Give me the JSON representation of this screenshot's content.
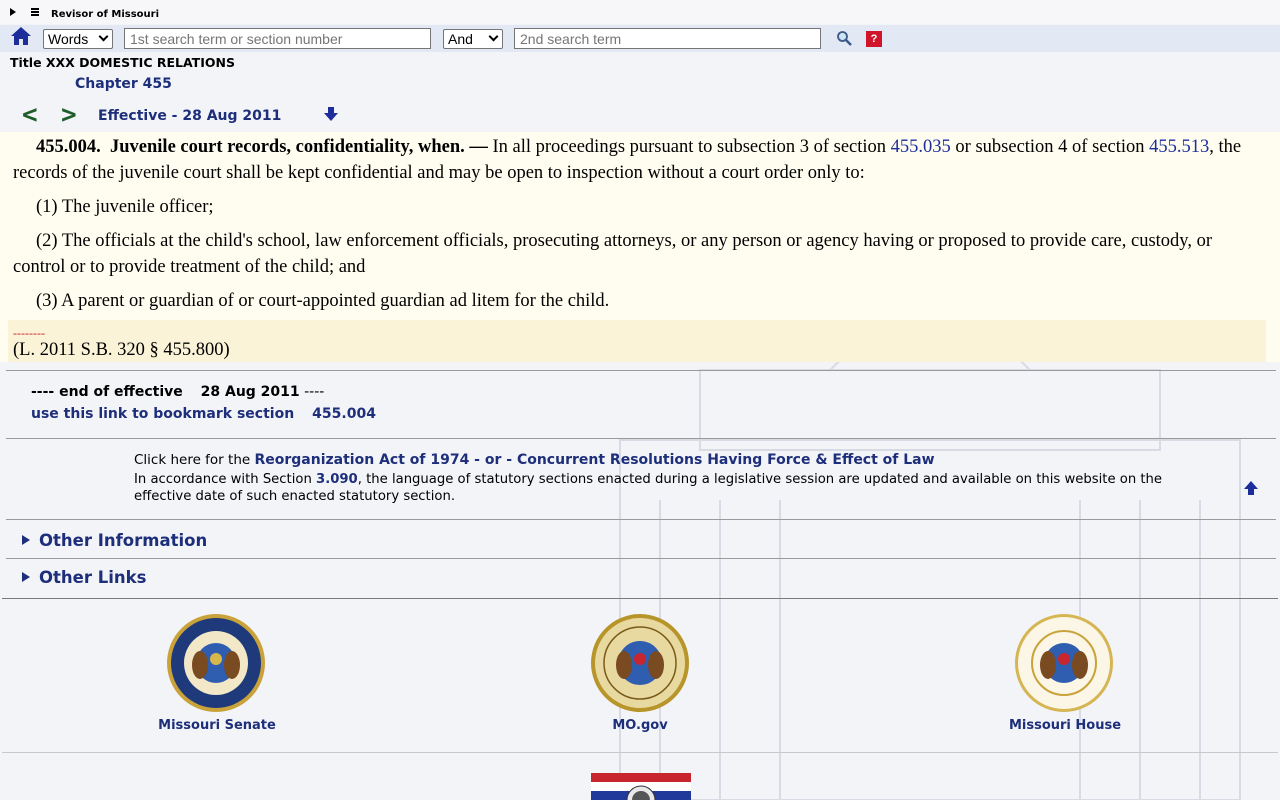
{
  "topbar": {
    "brand": "Revisor of Missouri"
  },
  "search": {
    "mode_selected": "Words",
    "term1_placeholder": "1st search term or section number",
    "operator_selected": "And",
    "term2_placeholder": "2nd search term",
    "help_label": "?"
  },
  "heading": {
    "title": "Title XXX DOMESTIC RELATIONS",
    "chapter": "Chapter 455",
    "prev": "<",
    "next": ">",
    "effective": "Effective - 28 Aug 2011"
  },
  "section": {
    "number": "455.004.",
    "heading": "Juvenile court records, confidentiality, when.",
    "dash": "—",
    "intro_a": "In all proceedings pursuant to subsection 3 of section",
    "link1": "455.035",
    "intro_b": "or subsection 4 of section",
    "link2": "455.513",
    "intro_c": ", the records of the juvenile court shall be kept confidential and may be open to inspection without a court order only to:",
    "item1": "(1)  The juvenile officer;",
    "item2": "(2)  The officials at the child's school, law enforcement officials, prosecuting attorneys, or any person or agency having or proposed to provide care, custody, or control or to provide treatment of the child; and",
    "item3": "(3)  A parent or guardian of or court-appointed guardian ad litem for the child.",
    "dashes": "--------",
    "history": "(L. 2011 S.B. 320 § 455.800)"
  },
  "end": {
    "prefix": "---- end of effective",
    "date": "28 Aug 2011",
    "suffix": "----",
    "bookmark_text": "use this link to bookmark section",
    "bookmark_section": "455.004"
  },
  "notice": {
    "click_prefix": "Click here for the",
    "click_link": "Reorganization Act of 1974 - or - Concurrent Resolutions Having Force & Effect of Law",
    "acc_prefix": "In accordance with Section",
    "acc_section": "3.090",
    "acc_rest": ", the language of statutory sections enacted during a legislative session are updated and available on this website on the effective date of such enacted statutory section."
  },
  "sections": {
    "other_information": "Other Information",
    "other_links": "Other Links"
  },
  "footer": {
    "senate": "Missouri Senate",
    "mogov": "MO.gov",
    "house": "Missouri House"
  },
  "colors": {
    "link_blue": "#1d2e7a",
    "nav_green": "#1e5e2a",
    "search_bar": "#e3e8f5",
    "statute_bg": "#fffdf0",
    "history_bg": "#fbf3d8",
    "help_red": "#d0152a"
  },
  "icons": [
    "home-icon",
    "search-icon",
    "help-icon",
    "down-arrow-icon",
    "up-arrow-icon",
    "expand-triangle-icon",
    "hamburger-icon"
  ]
}
